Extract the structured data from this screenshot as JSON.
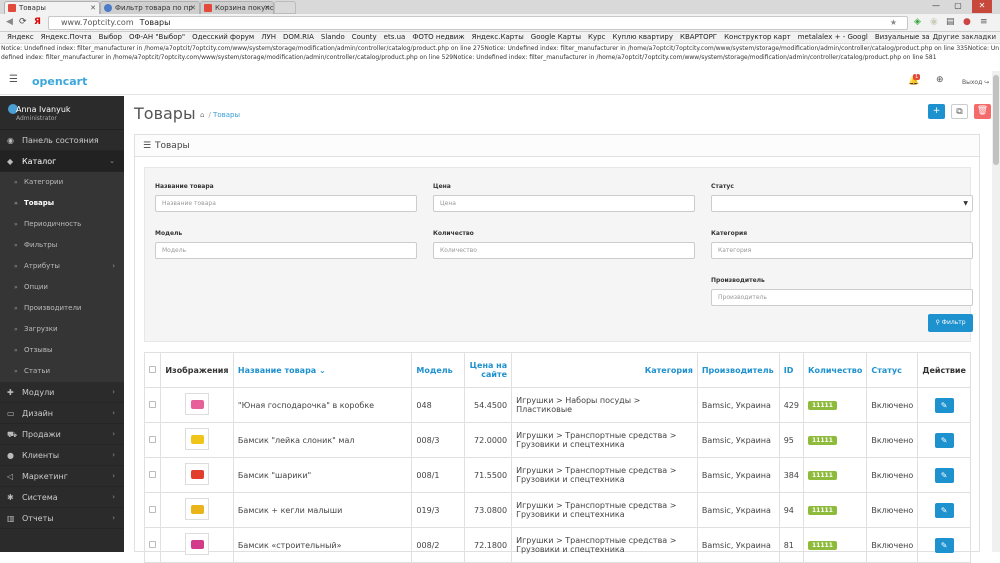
{
  "browser": {
    "tabs": [
      {
        "title": "Товары",
        "color": "#e24a3c"
      },
      {
        "title": "Фильтр товара по пр",
        "color": "#4a7cc9"
      },
      {
        "title": "Корзина покупок",
        "color": "#e24a3c"
      }
    ],
    "window_controls": [
      "—",
      "▢",
      "✕"
    ],
    "url": "www.7optcity.com",
    "url_title": "Товары",
    "bookmarks": [
      "Яндекс",
      "Яндекс.Почта",
      "Выбор",
      "ОФ-АН \"Выбор\"",
      "Одесский форум",
      "ЛУН",
      "DOM.RIA",
      "Slando",
      "County",
      "ets.ua",
      "ФОТО недвиж",
      "Яндекс.Карты",
      "Google Карты",
      "Курс",
      "Куплю квартиру",
      "КВАРТОРГ",
      "Конструктор карт",
      "metalalex + - Googl",
      "Визуальные закла"
    ],
    "other_bookmarks": "Другие закладки"
  },
  "notice": "Notice: Undefined index: filter_manufacturer in /home/a7optcit/7optcity.com/www/system/storage/modification/admin/controller/catalog/product.php on line 275Notice: Undefined index: filter_manufacturer in /home/a7optcit/7optcity.com/www/system/storage/modification/admin/controller/catalog/product.php on line 335Notice: Undefined index: filter_manufacturer in /home/a7optcit/7optcity.com/www/system/storage/modification/admin/controller/catalog/product.php on line 529Notice: Undefined index: filter_manufacturer in /home/a7optcit/7optcity.com/www/system/storage/modification/admin/controller/catalog/product.php on line 581",
  "header": {
    "logo": "opencart",
    "notification_count": "1",
    "logout": "Выход"
  },
  "sidebar": {
    "user_name": "Anna Ivanyuk",
    "user_role": "Administrator",
    "items": [
      {
        "label": "Панель состояния",
        "icon": "dashboard-icon"
      },
      {
        "label": "Каталог",
        "icon": "tag-icon",
        "active": true
      }
    ],
    "catalog_sub": [
      {
        "label": "Категории"
      },
      {
        "label": "Товары",
        "active": true
      },
      {
        "label": "Периодичность"
      },
      {
        "label": "Фильтры"
      },
      {
        "label": "Атрибуты",
        "has_children": true
      },
      {
        "label": "Опции"
      },
      {
        "label": "Производители"
      },
      {
        "label": "Загрузки"
      },
      {
        "label": "Отзывы"
      },
      {
        "label": "Статьи"
      }
    ],
    "bottom_items": [
      {
        "label": "Модули",
        "icon": "puzzle-icon"
      },
      {
        "label": "Дизайн",
        "icon": "monitor-icon"
      },
      {
        "label": "Продажи",
        "icon": "cart-icon"
      },
      {
        "label": "Клиенты",
        "icon": "user-icon"
      },
      {
        "label": "Маркетинг",
        "icon": "share-icon"
      },
      {
        "label": "Система",
        "icon": "cog-icon"
      },
      {
        "label": "Отчеты",
        "icon": "chart-icon"
      }
    ]
  },
  "page": {
    "title": "Товары",
    "breadcrumb": "Товары",
    "panel_title": "Товары"
  },
  "filter": {
    "name_label": "Название товара",
    "name_placeholder": "Название товара",
    "price_label": "Цена",
    "price_placeholder": "Цена",
    "status_label": "Статус",
    "status_value": "",
    "model_label": "Модель",
    "model_placeholder": "Модель",
    "qty_label": "Количество",
    "qty_placeholder": "Количество",
    "category_label": "Категория",
    "category_placeholder": "Категория",
    "manufacturer_label": "Производитель",
    "manufacturer_placeholder": "Производитель",
    "button": "Фильтр"
  },
  "table": {
    "headers": {
      "image": "Изображения",
      "name": "Название товара",
      "model": "Модель",
      "price": "Цена на сайте",
      "category": "Категория",
      "manufacturer": "Производитель",
      "id": "ID",
      "quantity": "Количество",
      "status": "Статус",
      "action": "Действие"
    },
    "rows": [
      {
        "name": "\"Юная господарочка\" в коробке",
        "model": "048",
        "price": "54.4500",
        "category": "Игрушки  >  Наборы посуды > Пластиковые",
        "manufacturer": "Bamsic, Украина",
        "id": "429",
        "quantity": "11111",
        "status": "Включено",
        "thumb_color": "#e8609a"
      },
      {
        "name": "Бамсик \"лейка слоник\" мал",
        "model": "008/3",
        "price": "72.0000",
        "category": "Игрушки  >  Транспортные средства > Грузовики и спецтехника",
        "manufacturer": "Bamsic, Украина",
        "id": "95",
        "quantity": "11111",
        "status": "Включено",
        "thumb_color": "#f0c419"
      },
      {
        "name": "Бамсик \"шарики\"",
        "model": "008/1",
        "price": "71.5500",
        "category": "Игрушки  >  Транспортные средства > Грузовики и спецтехника",
        "manufacturer": "Bamsic, Украина",
        "id": "384",
        "quantity": "11111",
        "status": "Включено",
        "thumb_color": "#e23c2c"
      },
      {
        "name": "Бамсик + кегли малыши",
        "model": "019/3",
        "price": "73.0800",
        "category": "Игрушки  >  Транспортные средства > Грузовики и спецтехника",
        "manufacturer": "Bamsic, Украина",
        "id": "94",
        "quantity": "11111",
        "status": "Включено",
        "thumb_color": "#e8b419"
      },
      {
        "name": "Бамсик «строительный»",
        "model": "008/2",
        "price": "72.1800",
        "category": "Игрушки  >  Транспортные средства > Грузовики и спецтехника",
        "manufacturer": "Bamsic, Украина",
        "id": "81",
        "quantity": "11111",
        "status": "Включено",
        "thumb_color": "#d23c8a"
      }
    ]
  },
  "colors": {
    "accent": "#1e91cf",
    "danger": "#f56b6b",
    "success": "#8fbb3c",
    "sidebar": "#2b2b2b"
  }
}
